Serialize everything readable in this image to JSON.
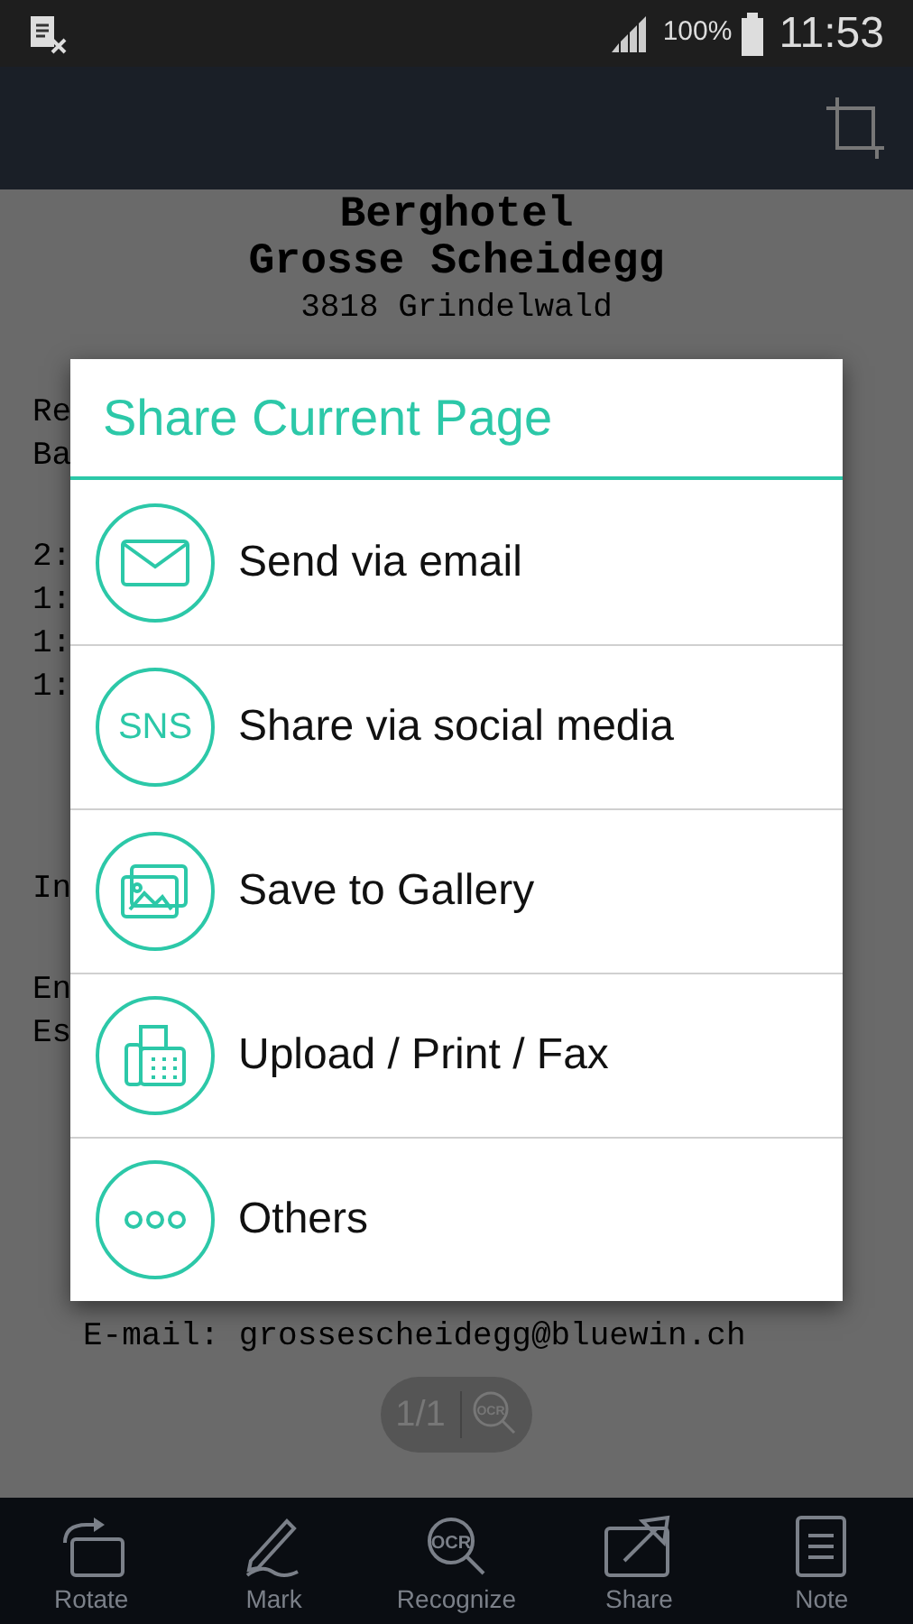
{
  "status_bar": {
    "battery": "100%",
    "time": "11:53"
  },
  "document": {
    "header_lines": [
      "Berghotel",
      "Grosse Scheidegg"
    ],
    "address": "3818 Grindelwald",
    "left_fragment_groups": [
      [
        "Re",
        "Ba"
      ],
      [
        "2:",
        "1:",
        "1:",
        "1:"
      ],
      [
        "In"
      ],
      [
        "En",
        "Es"
      ]
    ],
    "email": "E-mail: grossescheidegg@bluewin.ch",
    "page_indicator": "1/1",
    "ocr_label": "OCR"
  },
  "dialog": {
    "title": "Share Current Page",
    "options": [
      {
        "kind": "email",
        "label": "Send via email"
      },
      {
        "kind": "sns",
        "label": "Share via social media",
        "icon_text": "SNS"
      },
      {
        "kind": "gallery",
        "label": "Save to Gallery"
      },
      {
        "kind": "fax",
        "label": "Upload / Print / Fax"
      },
      {
        "kind": "others",
        "label": "Others"
      }
    ]
  },
  "toolbar": [
    {
      "kind": "rotate",
      "label": "Rotate"
    },
    {
      "kind": "mark",
      "label": "Mark"
    },
    {
      "kind": "ocr",
      "label": "Recognize",
      "icon_text": "OCR"
    },
    {
      "kind": "share",
      "label": "Share"
    },
    {
      "kind": "note",
      "label": "Note"
    }
  ]
}
